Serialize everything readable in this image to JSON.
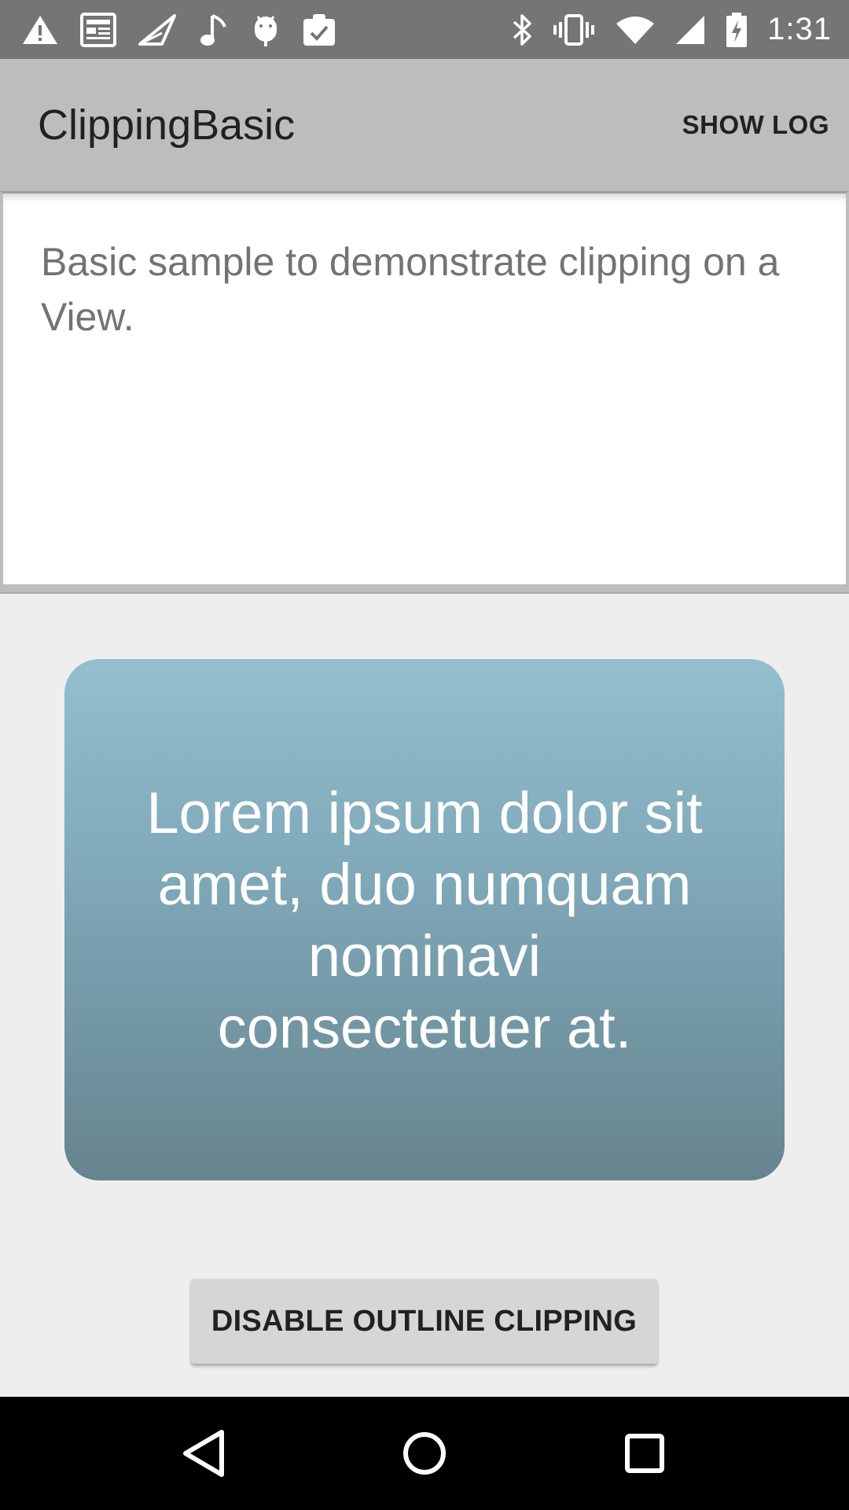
{
  "status_bar": {
    "time": "1:31",
    "left_icons": [
      "warning-icon",
      "news-icon",
      "send-icon",
      "music-note-icon",
      "android-debug-icon",
      "clipboard-check-icon"
    ],
    "right_icons": [
      "bluetooth-icon",
      "vibrate-icon",
      "wifi-icon",
      "cellular-signal-icon",
      "battery-charging-icon"
    ]
  },
  "action_bar": {
    "title": "ClippingBasic",
    "show_log_label": "SHOW LOG"
  },
  "intro": {
    "text": "Basic sample to demonstrate clipping on a View."
  },
  "card": {
    "text": "Lorem ipsum dolor sit amet, duo numquam nominavi consectetuer at."
  },
  "toggle_button": {
    "label": "DISABLE OUTLINE CLIPPING"
  },
  "nav_bar": {
    "icons": [
      "back-icon",
      "home-icon",
      "recents-icon"
    ]
  },
  "colors": {
    "status_bar": "#757575",
    "action_bar": "#bdbdbd",
    "background": "#eeeeee",
    "card_top": "#93bfcf",
    "card_bottom": "#66848f",
    "button": "#d6d6d6"
  }
}
